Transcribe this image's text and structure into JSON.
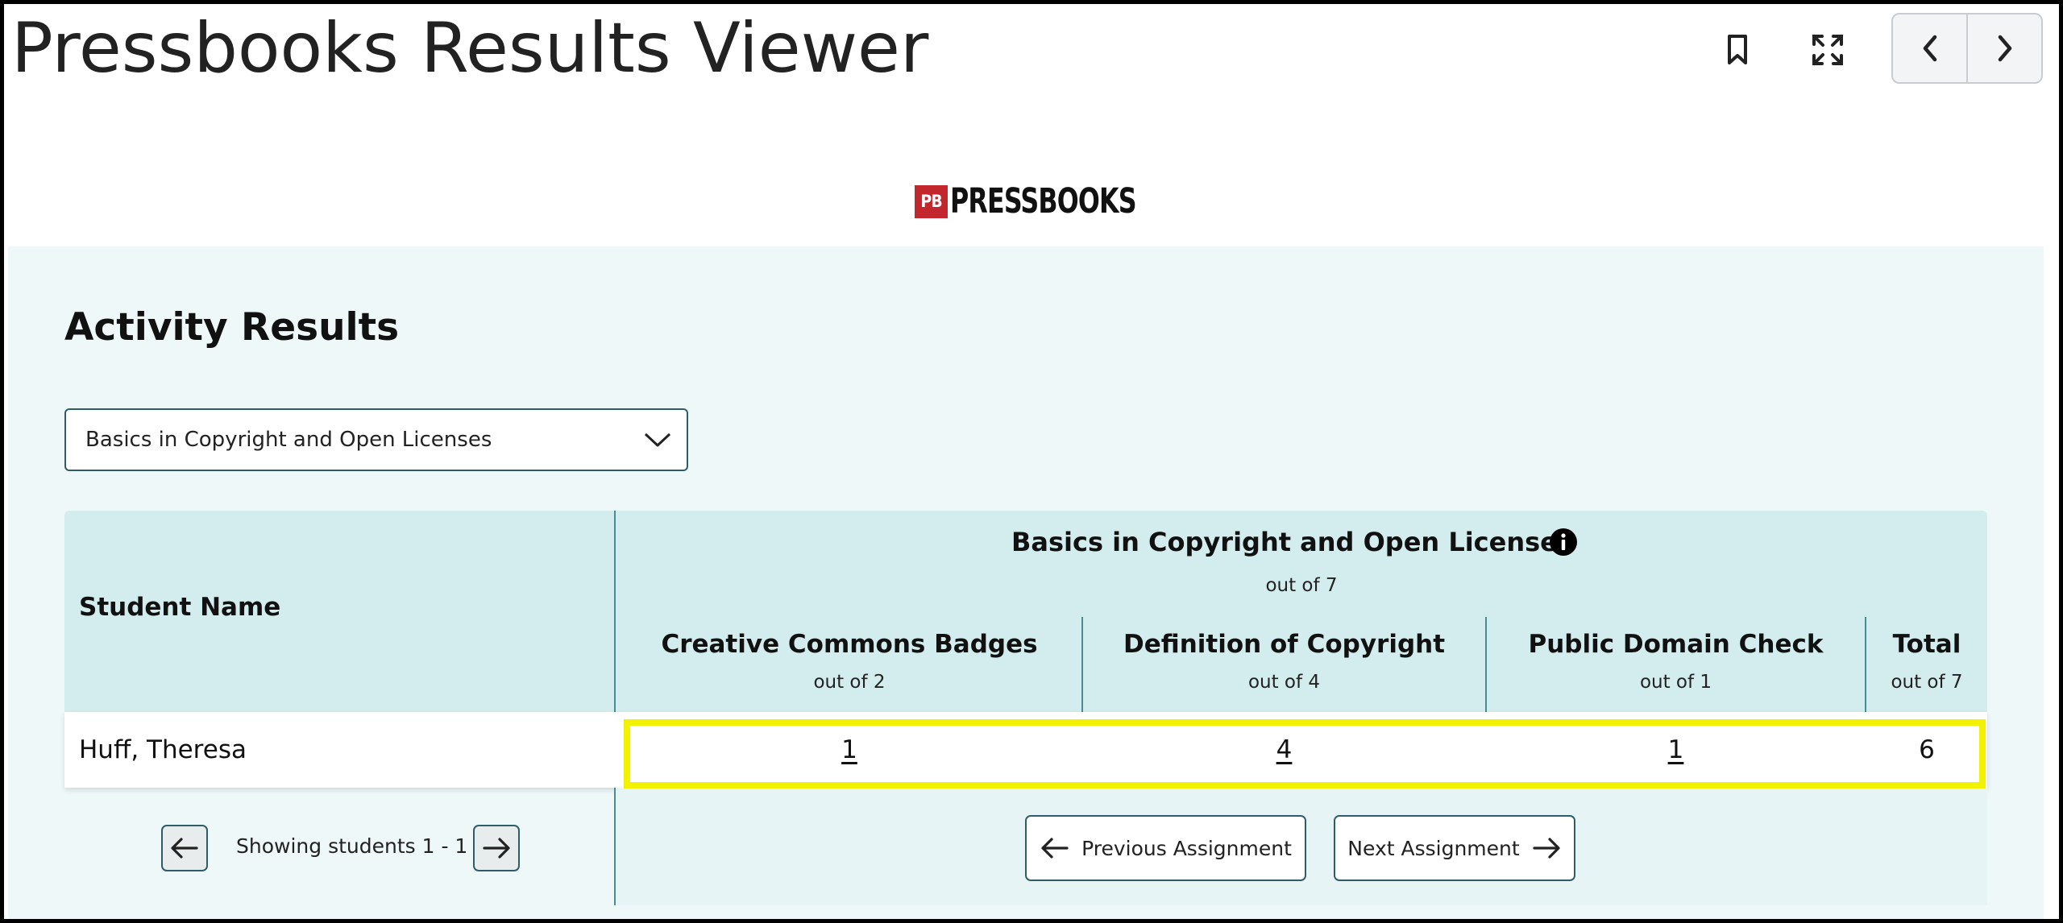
{
  "app": {
    "title": "Pressbooks Results Viewer"
  },
  "toolbar": {
    "bookmark_icon": "bookmark-icon",
    "fullscreen_icon": "fullscreen-icon",
    "prev_icon": "chevron-left-icon",
    "next_icon": "chevron-right-icon"
  },
  "logo": {
    "badge": "PB",
    "wordmark": "PRESSBOOKS",
    "badge_color": "#c2272d"
  },
  "main": {
    "heading": "Activity Results",
    "assignment_select": {
      "selected": "Basics in Copyright and Open Licenses"
    }
  },
  "table": {
    "name_header": "Student Name",
    "group": {
      "title": "Basics in Copyright and Open Licenses",
      "subtitle": "out of 7"
    },
    "columns": [
      {
        "title": "Creative Commons Badges",
        "subtitle": "out of 2"
      },
      {
        "title": "Definition of Copyright",
        "subtitle": "out of 4"
      },
      {
        "title": "Public Domain Check",
        "subtitle": "out of 1"
      },
      {
        "title": "Total",
        "subtitle": "out of 7"
      }
    ],
    "rows": [
      {
        "name": "Huff, Theresa",
        "scores": [
          "1",
          "4",
          "1",
          "6"
        ]
      }
    ]
  },
  "pager": {
    "text": "Showing students 1 - 1"
  },
  "assignment_nav": {
    "previous_label": "Previous Assignment",
    "next_label": "Next Assignment"
  },
  "colors": {
    "header_bg": "#d3ecee",
    "panel_bg": "#eef8f8",
    "accent_border": "#2f5d67",
    "highlight": "#f2f200"
  }
}
